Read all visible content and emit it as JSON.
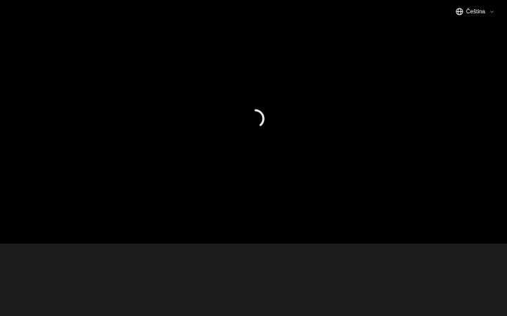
{
  "language_selector": {
    "label": "Čeština",
    "icon": "globe-icon",
    "dropdown_icon": "chevron-down-icon"
  },
  "loading": {
    "icon": "loading-spinner-icon"
  },
  "colors": {
    "background": "#000000",
    "footer": "#1c1c1c",
    "text": "#ffffff",
    "muted": "#7a7a7a"
  }
}
